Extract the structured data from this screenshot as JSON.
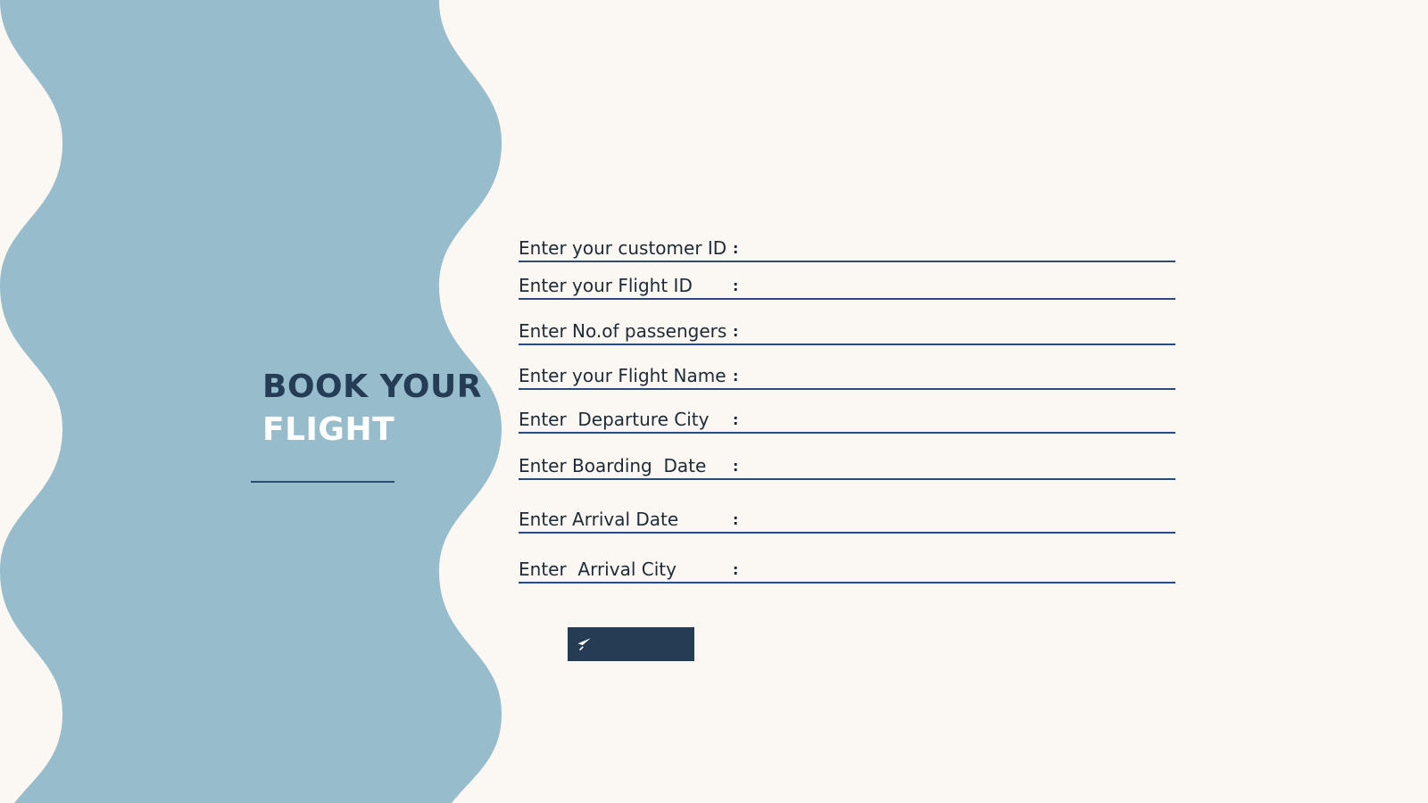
{
  "brand": {
    "wave_color": "#97bccc",
    "background_color": "#fbf7f2",
    "title_dark_color": "#243d55",
    "underline_color": "#2b4a80"
  },
  "header": {
    "title_line1": "BOOK YOUR",
    "title_line2": "FLIGHT"
  },
  "form": {
    "separator": ":",
    "fields": [
      {
        "label": "Enter your customer ID",
        "value": "",
        "placeholder": ""
      },
      {
        "label": "Enter your Flight ID",
        "value": "",
        "placeholder": ""
      },
      {
        "label": "Enter No.of passengers",
        "value": "",
        "placeholder": ""
      },
      {
        "label": "Enter your Flight Name",
        "value": "",
        "placeholder": ""
      },
      {
        "label": "Enter  Departure City",
        "value": "",
        "placeholder": ""
      },
      {
        "label": "Enter Boarding  Date",
        "value": "",
        "placeholder": ""
      },
      {
        "label": "Enter Arrival Date",
        "value": "",
        "placeholder": ""
      },
      {
        "label": "Enter  Arrival City",
        "value": "",
        "placeholder": ""
      }
    ],
    "submit": {
      "label": "",
      "icon": "airplane-icon",
      "color": "#243d55"
    }
  }
}
